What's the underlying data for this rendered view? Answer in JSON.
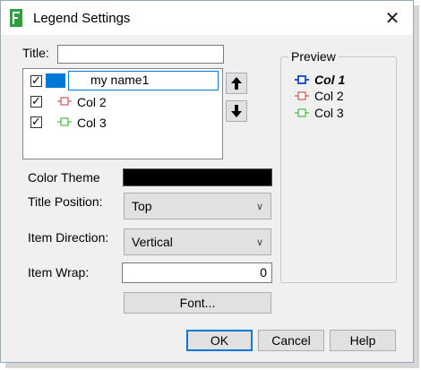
{
  "window": {
    "title": "Legend Settings",
    "close_glyph": "✕"
  },
  "form": {
    "title_label": "Title:",
    "title_value": "",
    "edit_value": "my name1",
    "items": [
      {
        "label": "my name1",
        "checked": true,
        "color": "#2255cc"
      },
      {
        "label": "Col 2",
        "checked": true,
        "color": "#cc3333"
      },
      {
        "label": "Col 3",
        "checked": true,
        "color": "#22aa22"
      }
    ],
    "color_theme_label": "Color Theme",
    "title_position_label": "Title Position:",
    "title_position_value": "Top",
    "item_direction_label": "Item Direction:",
    "item_direction_value": "Vertical",
    "item_wrap_label": "Item Wrap:",
    "item_wrap_value": "0",
    "font_button": "Font..."
  },
  "preview": {
    "title": "Preview",
    "items": [
      {
        "label": "Col 1",
        "color": "#2255cc"
      },
      {
        "label": "Col 2",
        "color": "#cc3333"
      },
      {
        "label": "Col 3",
        "color": "#22aa22"
      }
    ]
  },
  "buttons": {
    "ok": "OK",
    "cancel": "Cancel",
    "help": "Help"
  }
}
